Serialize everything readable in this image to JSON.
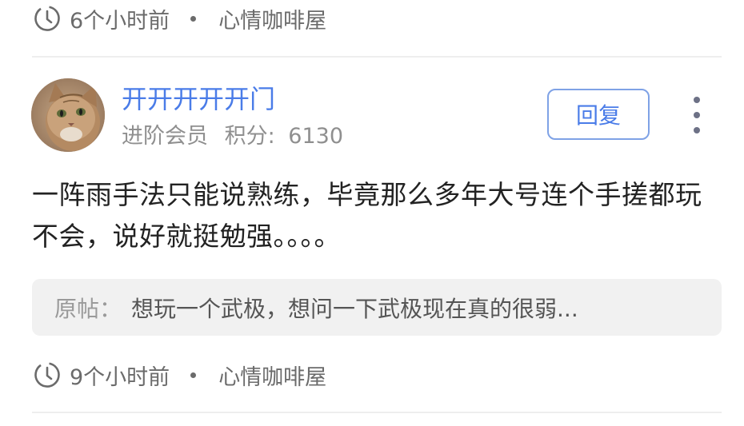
{
  "previous_post": {
    "time": "6个小时前",
    "board": "心情咖啡屋"
  },
  "reply": {
    "username": "开开开开开门",
    "member_level": "进阶会员",
    "score_label": "积分:",
    "score_value": "6130",
    "reply_button_label": "回复",
    "body": "一阵雨手法只能说熟练，毕竟那么多年大号连个手搓都玩不会，说好就挺勉强。。。。",
    "quote_label": "原帖",
    "quote_separator": "：",
    "quote_text": "想玩一个武极，想问一下武极现在真的很弱...",
    "time": "9个小时前",
    "board": "心情咖啡屋"
  },
  "colors": {
    "username": "#4a7ce8",
    "reply_button_border": "#7fa2e6",
    "meta_text": "#6b6b6b",
    "quote_background": "#f1f1f1"
  },
  "icons": {
    "clock": "clock-icon",
    "more": "more-vertical-icon",
    "avatar": "cat-avatar"
  }
}
